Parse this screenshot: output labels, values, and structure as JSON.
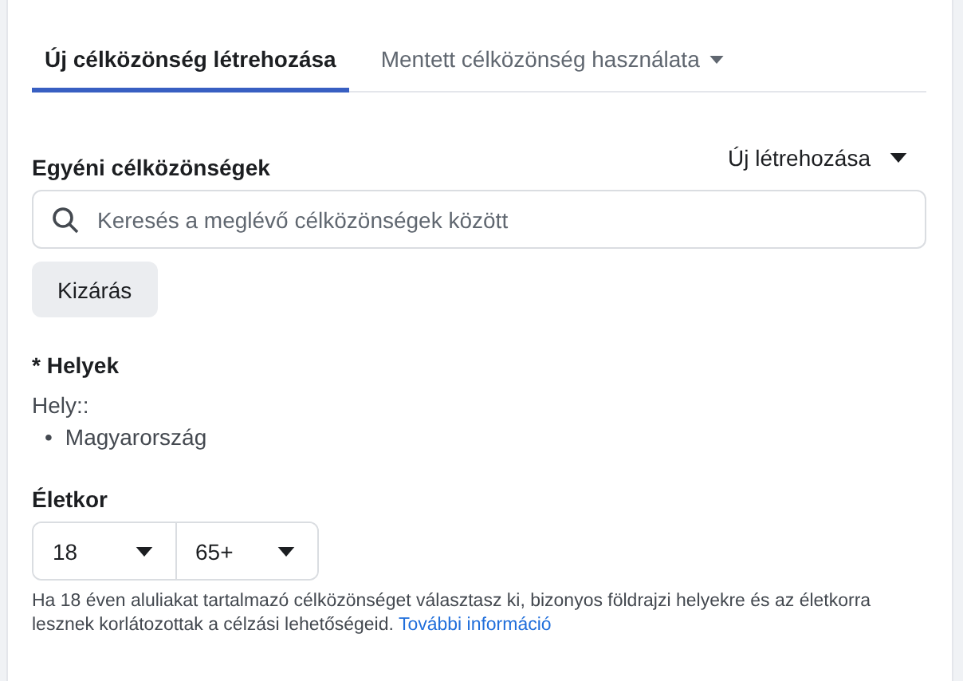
{
  "tabs": [
    {
      "label": "Új célközönség létrehozása",
      "selected": true,
      "has_menu": false
    },
    {
      "label": "Mentett célközönség használata",
      "selected": false,
      "has_menu": true
    }
  ],
  "custom_audiences": {
    "title": "Egyéni célközönségek",
    "create_menu": "Új létrehozása",
    "search": {
      "placeholder": "Keresés a meglévő célközönségek között"
    },
    "exclude_button": "Kizárás"
  },
  "locations": {
    "title": "* Helyek",
    "label": "Hely::",
    "items": [
      {
        "bullet": "•",
        "text": "Magyarország"
      }
    ]
  },
  "age": {
    "title": "Életkor",
    "min": "18",
    "max": "65+",
    "note": "Ha 18 éven aluliakat tartalmazó célközönséget választasz ki, bizonyos földrajzi helyekre és az életkorra lesznek korlátozottak a célzási lehetőségeid.",
    "link": "További információ"
  }
}
